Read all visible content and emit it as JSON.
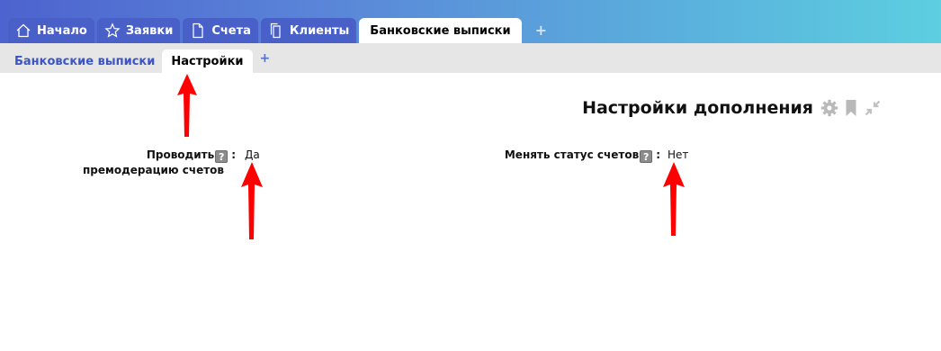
{
  "main_tabs": [
    {
      "label": "Начало",
      "icon": "home-icon"
    },
    {
      "label": "Заявки",
      "icon": "star-icon"
    },
    {
      "label": "Счета",
      "icon": "document-icon"
    },
    {
      "label": "Клиенты",
      "icon": "copy-icon"
    },
    {
      "label": "Банковские выписки",
      "active": true
    }
  ],
  "main_tab_add": "+",
  "sub_tabs": [
    {
      "label": "Банковские выписки"
    },
    {
      "label": "Настройки",
      "active": true
    }
  ],
  "sub_tab_add": "+",
  "page": {
    "title": "Настройки дополнения",
    "icons": [
      "gear-icon",
      "bookmark-icon",
      "collapse-icon"
    ]
  },
  "fields": [
    {
      "label_line1": "Проводить",
      "label_line2": "премодерацию счетов",
      "help": "?",
      "colon": ":",
      "value": "Да"
    },
    {
      "label": "Менять статус счетов",
      "help": "?",
      "colon": ":",
      "value": "Нет"
    }
  ],
  "colors": {
    "accent": "#4a60c9",
    "annotation_arrow": "#ff0000"
  }
}
